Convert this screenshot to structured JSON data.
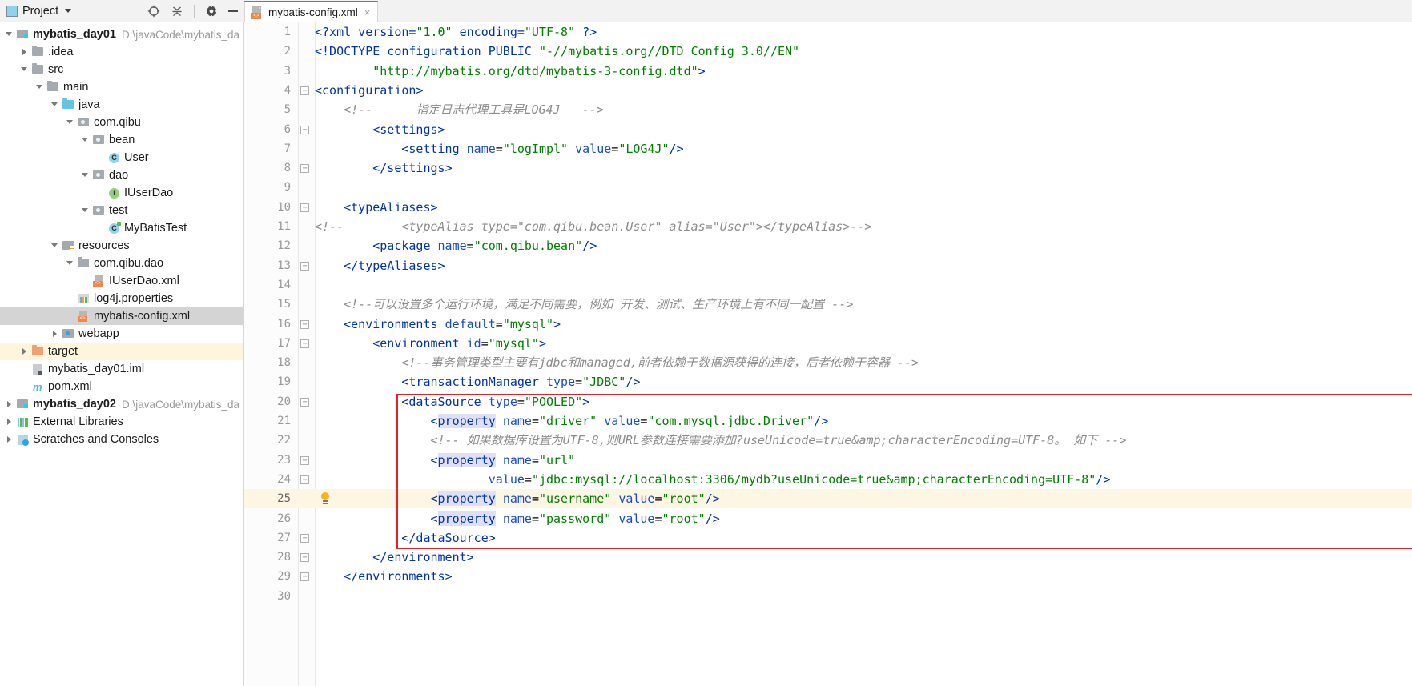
{
  "window": {
    "project_panel_title": "Project",
    "toolbar_icons": [
      "locate-icon",
      "collapse-all-icon",
      "gear-icon",
      "minimize-icon"
    ]
  },
  "tab": {
    "label": "mybatis-config.xml",
    "icon": "xml-file-icon",
    "close_label": "×"
  },
  "tree": {
    "items": [
      {
        "label": "mybatis_day01",
        "path": "D:\\javaCode\\mybatis_da",
        "indent": 0,
        "arrow": "open",
        "icon": "module-folder-icon",
        "bold": true,
        "state": "normal"
      },
      {
        "label": ".idea",
        "path": "",
        "indent": 1,
        "arrow": "closed",
        "icon": "folder-icon",
        "bold": false,
        "state": "normal"
      },
      {
        "label": "src",
        "path": "",
        "indent": 1,
        "arrow": "open",
        "icon": "folder-icon",
        "bold": false,
        "state": "normal"
      },
      {
        "label": "main",
        "path": "",
        "indent": 2,
        "arrow": "open",
        "icon": "folder-icon",
        "bold": false,
        "state": "normal"
      },
      {
        "label": "java",
        "path": "",
        "indent": 3,
        "arrow": "open",
        "icon": "source-folder-icon",
        "bold": false,
        "state": "normal"
      },
      {
        "label": "com.qibu",
        "path": "",
        "indent": 4,
        "arrow": "open",
        "icon": "package-icon",
        "bold": false,
        "state": "normal"
      },
      {
        "label": "bean",
        "path": "",
        "indent": 5,
        "arrow": "open",
        "icon": "package-icon",
        "bold": false,
        "state": "normal"
      },
      {
        "label": "User",
        "path": "",
        "indent": 6,
        "arrow": "none",
        "icon": "java-class-icon",
        "bold": false,
        "state": "normal"
      },
      {
        "label": "dao",
        "path": "",
        "indent": 5,
        "arrow": "open",
        "icon": "package-icon",
        "bold": false,
        "state": "normal"
      },
      {
        "label": "IUserDao",
        "path": "",
        "indent": 6,
        "arrow": "none",
        "icon": "java-interface-icon",
        "bold": false,
        "state": "normal"
      },
      {
        "label": "test",
        "path": "",
        "indent": 5,
        "arrow": "open",
        "icon": "package-icon",
        "bold": false,
        "state": "normal"
      },
      {
        "label": "MyBatisTest",
        "path": "",
        "indent": 6,
        "arrow": "none",
        "icon": "java-test-class-icon",
        "bold": false,
        "state": "normal"
      },
      {
        "label": "resources",
        "path": "",
        "indent": 3,
        "arrow": "open",
        "icon": "resources-folder-icon",
        "bold": false,
        "state": "normal"
      },
      {
        "label": "com.qibu.dao",
        "path": "",
        "indent": 4,
        "arrow": "open",
        "icon": "folder-icon",
        "bold": false,
        "state": "normal"
      },
      {
        "label": "IUserDao.xml",
        "path": "",
        "indent": 5,
        "arrow": "none",
        "icon": "xml-file-icon",
        "bold": false,
        "state": "normal"
      },
      {
        "label": "log4j.properties",
        "path": "",
        "indent": 4,
        "arrow": "none",
        "icon": "properties-file-icon",
        "bold": false,
        "state": "normal"
      },
      {
        "label": "mybatis-config.xml",
        "path": "",
        "indent": 4,
        "arrow": "none",
        "icon": "xml-file-icon",
        "bold": false,
        "state": "selected"
      },
      {
        "label": "webapp",
        "path": "",
        "indent": 3,
        "arrow": "closed",
        "icon": "webapp-folder-icon",
        "bold": false,
        "state": "normal"
      },
      {
        "label": "target",
        "path": "",
        "indent": 1,
        "arrow": "closed",
        "icon": "excluded-folder-icon",
        "bold": false,
        "state": "highlighted"
      },
      {
        "label": "mybatis_day01.iml",
        "path": "",
        "indent": 1,
        "arrow": "none",
        "icon": "iml-file-icon",
        "bold": false,
        "state": "normal"
      },
      {
        "label": "pom.xml",
        "path": "",
        "indent": 1,
        "arrow": "none",
        "icon": "maven-file-icon",
        "bold": false,
        "state": "normal"
      },
      {
        "label": "mybatis_day02",
        "path": "D:\\javaCode\\mybatis_da",
        "indent": 0,
        "arrow": "closed",
        "icon": "module-folder-icon",
        "bold": true,
        "state": "normal"
      },
      {
        "label": "External Libraries",
        "path": "",
        "indent": 0,
        "arrow": "closed",
        "icon": "libraries-icon",
        "bold": false,
        "state": "normal"
      },
      {
        "label": "Scratches and Consoles",
        "path": "",
        "indent": 0,
        "arrow": "closed",
        "icon": "scratches-icon",
        "bold": false,
        "state": "normal"
      }
    ]
  },
  "editor": {
    "current_line": 25,
    "bulb_line": 25,
    "red_box": {
      "from_line": 20,
      "to_line": 27
    },
    "lines": [
      {
        "n": 1,
        "fold": "none",
        "text": "<?xml version=\"1.0\" encoding=\"UTF-8\" ?>"
      },
      {
        "n": 2,
        "fold": "none",
        "text": "<!DOCTYPE configuration PUBLIC \"-//mybatis.org//DTD Config 3.0//EN\""
      },
      {
        "n": 3,
        "fold": "none",
        "text": "        \"http://mybatis.org/dtd/mybatis-3-config.dtd\">"
      },
      {
        "n": 4,
        "fold": "open",
        "text": "<configuration>"
      },
      {
        "n": 5,
        "fold": "none",
        "text": "    <!--      指定日志代理工具是LOG4J   -->"
      },
      {
        "n": 6,
        "fold": "open",
        "text": "        <settings>"
      },
      {
        "n": 7,
        "fold": "none",
        "text": "            <setting name=\"logImpl\" value=\"LOG4J\"/>"
      },
      {
        "n": 8,
        "fold": "close",
        "text": "        </settings>"
      },
      {
        "n": 9,
        "fold": "none",
        "text": ""
      },
      {
        "n": 10,
        "fold": "open",
        "text": "    <typeAliases>"
      },
      {
        "n": 11,
        "fold": "none",
        "text": "<!--        <typeAlias type=\"com.qibu.bean.User\" alias=\"User\"></typeAlias>-->"
      },
      {
        "n": 12,
        "fold": "none",
        "text": "        <package name=\"com.qibu.bean\"/>"
      },
      {
        "n": 13,
        "fold": "close",
        "text": "    </typeAliases>"
      },
      {
        "n": 14,
        "fold": "none",
        "text": ""
      },
      {
        "n": 15,
        "fold": "none",
        "text": "    <!--可以设置多个运行环境，满足不同需要，例如 开发、测试、生产环境上有不同一配置 -->"
      },
      {
        "n": 16,
        "fold": "open",
        "text": "    <environments default=\"mysql\">"
      },
      {
        "n": 17,
        "fold": "open",
        "text": "        <environment id=\"mysql\">"
      },
      {
        "n": 18,
        "fold": "none",
        "text": "            <!--事务管理类型主要有jdbc和managed,前者依赖于数据源获得的连接，后者依赖于容器 -->"
      },
      {
        "n": 19,
        "fold": "none",
        "text": "            <transactionManager type=\"JDBC\"/>"
      },
      {
        "n": 20,
        "fold": "open",
        "text": "            <dataSource type=\"POOLED\">"
      },
      {
        "n": 21,
        "fold": "none",
        "text": "                <property name=\"driver\" value=\"com.mysql.jdbc.Driver\"/>"
      },
      {
        "n": 22,
        "fold": "none",
        "text": "                <!-- 如果数据库设置为UTF-8,则URL参数连接需要添加?useUnicode=true&amp;characterEncoding=UTF-8。 如下 -->"
      },
      {
        "n": 23,
        "fold": "open",
        "text": "                <property name=\"url\""
      },
      {
        "n": 24,
        "fold": "close",
        "text": "                        value=\"jdbc:mysql://localhost:3306/mydb?useUnicode=true&amp;characterEncoding=UTF-8\"/>"
      },
      {
        "n": 25,
        "fold": "none",
        "text": "                <property name=\"username\" value=\"root\"/>"
      },
      {
        "n": 26,
        "fold": "none",
        "text": "                <property name=\"password\" value=\"root\"/>"
      },
      {
        "n": 27,
        "fold": "close",
        "text": "            </dataSource>"
      },
      {
        "n": 28,
        "fold": "close",
        "text": "        </environment>"
      },
      {
        "n": 29,
        "fold": "close",
        "text": "    </environments>"
      },
      {
        "n": 30,
        "fold": "none",
        "text": ""
      }
    ]
  },
  "colors": {
    "tag": "#0033b3",
    "attribute": "#174ad4",
    "value": "#008000",
    "comment": "#8c8c8c",
    "selection": "#d4d4d4",
    "highlight_row": "#fdf6dd",
    "current_line": "#fdf6e3",
    "red_box": "#e8202a",
    "accent": "#4083c9"
  }
}
